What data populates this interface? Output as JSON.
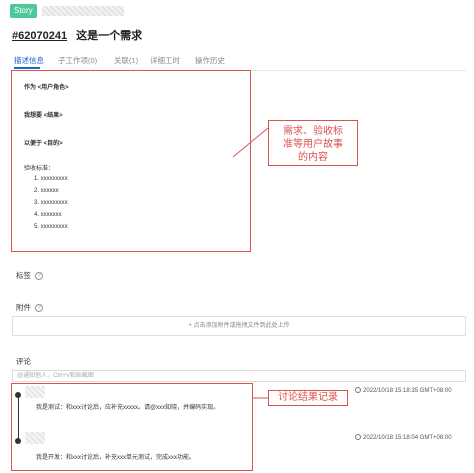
{
  "header": {
    "type_tag": "Story",
    "item_id": "#62070241",
    "item_title": "这是一个需求"
  },
  "tabs": [
    {
      "label": "描述信息",
      "active": true
    },
    {
      "label": "子工作项(0)",
      "active": false
    },
    {
      "label": "关联(1)",
      "active": false
    },
    {
      "label": "详细工时",
      "active": false
    },
    {
      "label": "操作历史",
      "active": false
    }
  ],
  "description": {
    "as_line": "作为 <用户角色>",
    "want_line": "我想要 <结果>",
    "so_that_line": "以便于 <目的>",
    "criteria_label": "验收标准：",
    "criteria": [
      "1. xxxxxxxxx",
      "2. xxxxxx",
      "3. xxxxxxxxx",
      "4. xxxxxxx",
      "5. xxxxxxxxx"
    ]
  },
  "annotations": {
    "story_callout": "需求、验收标准等用户故事的内容",
    "story_callout_lines": [
      "需求、验收标",
      "准等用户故事",
      "的内容"
    ],
    "discussion_callout": "讨论结果记录"
  },
  "labels_section": {
    "title": "标签",
    "help": "?"
  },
  "attachments_section": {
    "title": "附件",
    "help": "?",
    "upload_hint": "+ 点击添加附件或拖拽文件到此处上传"
  },
  "comments_section": {
    "title": "评论",
    "input_placeholder": "@通知他人，Ctrl+V粘贴截图",
    "comments": [
      {
        "text": "我是测试：和xxx讨论后，应补充xxxxx。请@xxx知晓，并编码实现。",
        "time": "2022/10/18 15:18:35 GMT+08:00"
      },
      {
        "text": "我是开发：和xxx讨论后，补充xxx单元测试，完成xxx功能。",
        "time": "2022/10/18 15:18:04 GMT+08:00"
      }
    ]
  },
  "colors": {
    "accent": "#2266cc",
    "annotation_red": "#d9534f",
    "story_tag": "#4cc99a"
  }
}
